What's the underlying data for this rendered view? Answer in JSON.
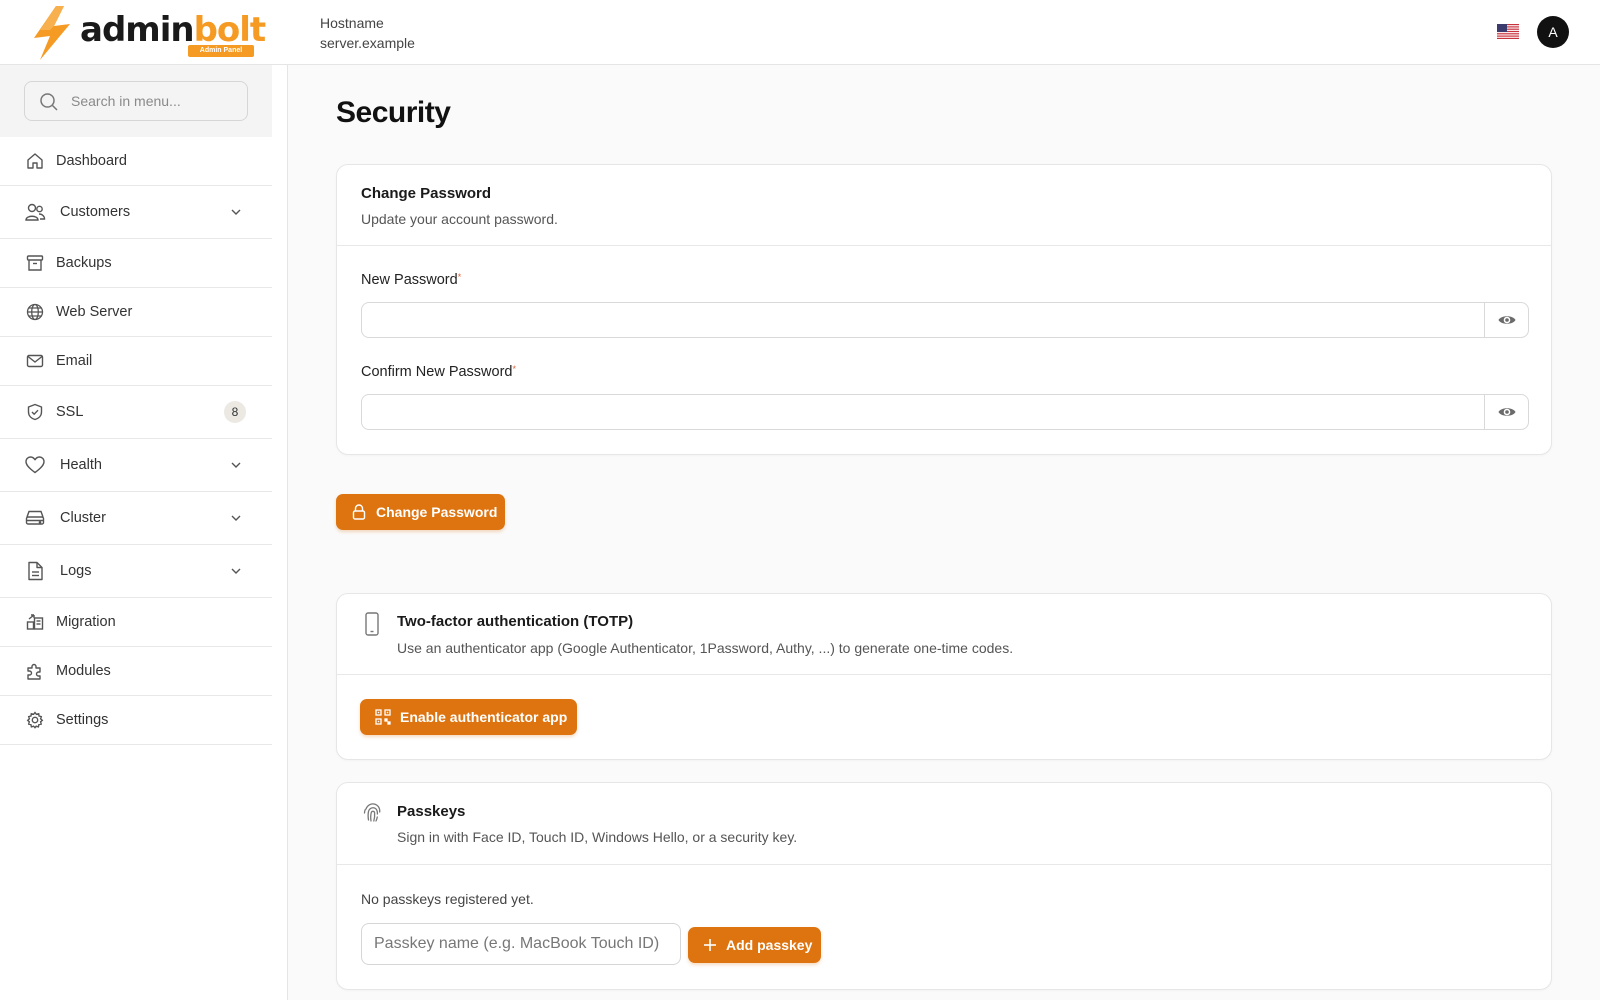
{
  "header": {
    "logo_text_dark": "admin",
    "logo_text_accent": "bolt",
    "logo_badge": "Admin Panel",
    "host_label": "Hostname",
    "host_value": "server.example",
    "avatar_initial": "A"
  },
  "sidebar": {
    "search_placeholder": "Search in menu...",
    "items": [
      {
        "label": "Dashboard",
        "icon": "home-icon"
      },
      {
        "label": "Customers",
        "icon": "users-icon",
        "expandable": true
      },
      {
        "label": "Backups",
        "icon": "archive-icon"
      },
      {
        "label": "Web Server",
        "icon": "globe-icon"
      },
      {
        "label": "Email",
        "icon": "mail-icon"
      },
      {
        "label": "SSL",
        "icon": "shield-icon",
        "badge": "8"
      },
      {
        "label": "Health",
        "icon": "heart-icon",
        "expandable": true
      },
      {
        "label": "Cluster",
        "icon": "server-icon",
        "expandable": true
      },
      {
        "label": "Logs",
        "icon": "file-icon",
        "expandable": true
      },
      {
        "label": "Migration",
        "icon": "migration-icon"
      },
      {
        "label": "Modules",
        "icon": "puzzle-icon"
      },
      {
        "label": "Settings",
        "icon": "gear-icon"
      }
    ]
  },
  "main": {
    "page_title": "Security",
    "change_password": {
      "title": "Change Password",
      "description": "Update your account password.",
      "new_password_label": "New Password",
      "confirm_password_label": "Confirm New Password",
      "required_marker": "*",
      "submit_label": "Change Password"
    },
    "totp": {
      "title": "Two-factor authentication (TOTP)",
      "description": "Use an authenticator app (Google Authenticator, 1Password, Authy, ...) to generate one-time codes.",
      "enable_label": "Enable authenticator app"
    },
    "passkeys": {
      "title": "Passkeys",
      "description": "Sign in with Face ID, Touch ID, Windows Hello, or a security key.",
      "empty_text": "No passkeys registered yet.",
      "name_placeholder": "Passkey name (e.g. MacBook Touch ID)",
      "add_label": "Add passkey"
    }
  },
  "colors": {
    "accent": "#dd7410",
    "brand_orange": "#f59a23",
    "required": "#e0623a"
  }
}
